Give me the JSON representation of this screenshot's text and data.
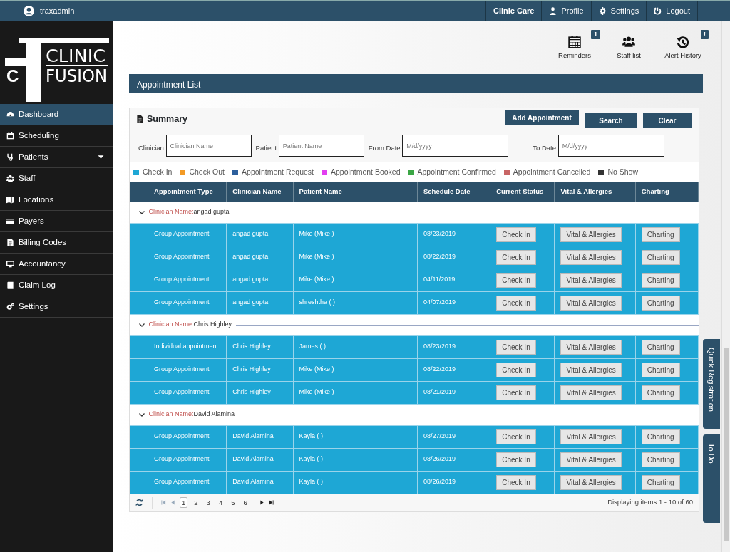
{
  "user": {
    "name": "traxadmin"
  },
  "top_nav": [
    {
      "label": "Clinic Care",
      "kind": "brand"
    },
    {
      "label": "Profile",
      "kind": "link"
    },
    {
      "label": "Settings",
      "kind": "link"
    },
    {
      "label": "Logout",
      "kind": "link"
    }
  ],
  "logo": {
    "letter": "C",
    "line1": "CLINIC",
    "line2": "FUSION"
  },
  "sidebar": {
    "items": [
      {
        "label": "Dashboard",
        "selected": true
      },
      {
        "label": "Scheduling",
        "selected": false
      },
      {
        "label": "Patients",
        "selected": false,
        "expanded": false
      },
      {
        "label": "Staff",
        "selected": false
      },
      {
        "label": "Locations",
        "selected": false
      },
      {
        "label": "Payers",
        "selected": false
      },
      {
        "label": "Billing Codes",
        "selected": false
      },
      {
        "label": "Accountancy",
        "selected": false
      },
      {
        "label": "Claim Log",
        "selected": false
      },
      {
        "label": "Settings",
        "selected": false
      }
    ]
  },
  "toolbar": [
    {
      "label": "Reminders",
      "badge": "1"
    },
    {
      "label": "Staff list"
    },
    {
      "label": "Alert History",
      "badge": "!"
    }
  ],
  "page_title": "Appointment List",
  "summary": {
    "title": "Summary",
    "buttons": [
      "Add Appointment",
      "Search",
      "Clear"
    ]
  },
  "filters": [
    {
      "label": "Clinician:",
      "placeholder": "Clinician Name"
    },
    {
      "label": "Patient:",
      "placeholder": "Patient Name"
    },
    {
      "label": "From Date:",
      "placeholder": "M/d/yyyy"
    },
    {
      "label": "To Date:",
      "placeholder": "M/d/yyyy"
    }
  ],
  "legend": [
    {
      "label": "Check In",
      "color": "#1ea7d5"
    },
    {
      "label": "Check Out",
      "color": "#f39a25"
    },
    {
      "label": "Appointment Request",
      "color": "#2d5f9c"
    },
    {
      "label": "Appointment Booked",
      "color": "#e23ff0"
    },
    {
      "label": "Appointment Confirmed",
      "color": "#3ba645"
    },
    {
      "label": "Appointment Cancelled",
      "color": "#c86565"
    },
    {
      "label": "No Show",
      "color": "#333333"
    }
  ],
  "table": {
    "columns": [
      "Appointment Type",
      "Clinician Name",
      "Patient Name",
      "Schedule Date",
      "Current Status",
      "Vital & Allergies",
      "Charting"
    ],
    "groups": [
      {
        "label": "Clinician Name:",
        "name": "angad gupta",
        "expanded": true,
        "rows": [
          {
            "type": "Group Appointment",
            "clinician": "angad gupta",
            "patient": "Mike (Mike )",
            "date": "08/23/2019",
            "status_button": "Check In",
            "vitals_button": "Vital & Allergies",
            "charting_button": "Charting"
          },
          {
            "type": "Group Appointment",
            "clinician": "angad gupta",
            "patient": "Mike (Mike )",
            "date": "08/22/2019",
            "status_button": "Check In",
            "vitals_button": "Vital & Allergies",
            "charting_button": "Charting"
          },
          {
            "type": "Group Appointment",
            "clinician": "angad gupta",
            "patient": "Mike (Mike )",
            "date": "04/11/2019",
            "status_button": "Check In",
            "vitals_button": "Vital & Allergies",
            "charting_button": "Charting"
          },
          {
            "type": "Group Appointment",
            "clinician": "angad gupta",
            "patient": "shreshtha ( )",
            "date": "04/07/2019",
            "status_button": "Check In",
            "vitals_button": "Vital & Allergies",
            "charting_button": "Charting"
          }
        ]
      },
      {
        "label": "Clinician Name:",
        "name": "Chris Highley",
        "expanded": true,
        "rows": [
          {
            "type": "Individual appointment",
            "clinician": "Chris Highley",
            "patient": "James ( )",
            "date": "08/23/2019",
            "status_button": "Check In",
            "vitals_button": "Vital & Allergies",
            "charting_button": "Charting"
          },
          {
            "type": "Group Appointment",
            "clinician": "Chris Highley",
            "patient": "Mike (Mike )",
            "date": "08/22/2019",
            "status_button": "Check In",
            "vitals_button": "Vital & Allergies",
            "charting_button": "Charting"
          },
          {
            "type": "Group Appointment",
            "clinician": "Chris Highley",
            "patient": "Mike (Mike )",
            "date": "08/21/2019",
            "status_button": "Check In",
            "vitals_button": "Vital & Allergies",
            "charting_button": "Charting"
          }
        ]
      },
      {
        "label": "Clinician Name:",
        "name": "David Alamina",
        "expanded": true,
        "rows": [
          {
            "type": "Group Appointment",
            "clinician": "David Alamina",
            "patient": "Kayla ( )",
            "date": "08/27/2019",
            "status_button": "Check In",
            "vitals_button": "Vital & Allergies",
            "charting_button": "Charting"
          },
          {
            "type": "Group Appointment",
            "clinician": "David Alamina",
            "patient": "Kayla ( )",
            "date": "08/26/2019",
            "status_button": "Check In",
            "vitals_button": "Vital & Allergies",
            "charting_button": "Charting"
          },
          {
            "type": "Group Appointment",
            "clinician": "David Alamina",
            "patient": "Kayla ( )",
            "date": "08/26/2019",
            "status_button": "Check In",
            "vitals_button": "Vital & Allergies",
            "charting_button": "Charting"
          }
        ]
      }
    ]
  },
  "pager": {
    "pages": [
      {
        "label": "1",
        "selected": true
      },
      {
        "label": "2",
        "selected": false
      },
      {
        "label": "3",
        "selected": false
      },
      {
        "label": "4",
        "selected": false
      },
      {
        "label": "5",
        "selected": false
      },
      {
        "label": "6",
        "selected": false
      }
    ],
    "info": "Displaying items 1 - 10 of 60"
  },
  "side_tabs": [
    "Quick Registration",
    "To Do"
  ]
}
